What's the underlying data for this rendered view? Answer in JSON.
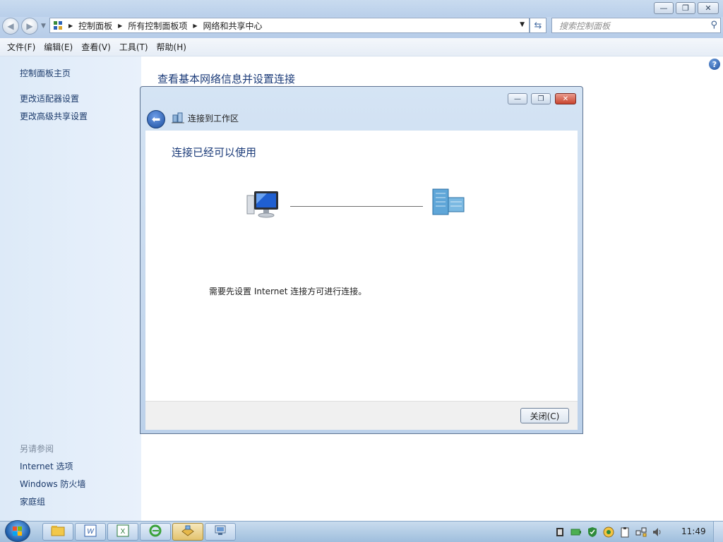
{
  "window": {
    "caption_buttons": {
      "minimize": "—",
      "maximize": "❐",
      "close": "✕"
    }
  },
  "address": {
    "breadcrumbs": [
      "控制面板",
      "所有控制面板项",
      "网络和共享中心"
    ],
    "search_placeholder": "搜索控制面板"
  },
  "menu": [
    "文件(F)",
    "编辑(E)",
    "查看(V)",
    "工具(T)",
    "帮助(H)"
  ],
  "sidebar": {
    "home": "控制面板主页",
    "links": [
      "更改适配器设置",
      "更改高级共享设置"
    ],
    "see_also_heading": "另请参阅",
    "see_also": [
      "Internet 选项",
      "Windows 防火墙",
      "家庭组"
    ]
  },
  "main": {
    "title": "查看基本网络信息并设置连接"
  },
  "dialog": {
    "title": "连接到工作区",
    "heading": "连接已经可以使用",
    "message": "需要先设置 Internet 连接方可进行连接。",
    "close_button": "关闭(C)"
  },
  "taskbar": {
    "apps": [
      "explorer-icon",
      "word-icon",
      "excel-icon",
      "ie-icon",
      "network-wizard-icon",
      "remote-desktop-icon"
    ],
    "tray_icons": [
      "film-icon",
      "battery-icon",
      "shield-icon",
      "security-icon",
      "clipboard-icon",
      "network-icon",
      "volume-icon"
    ],
    "clock": "11:49"
  }
}
